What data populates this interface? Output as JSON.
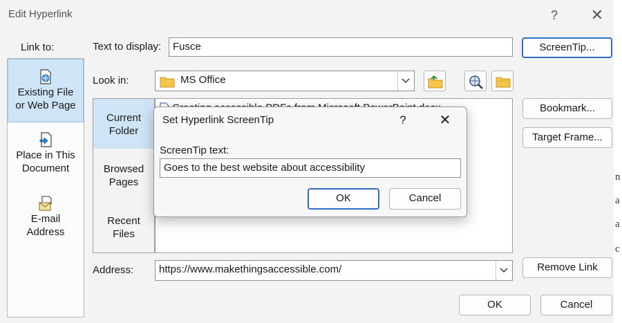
{
  "dialog": {
    "title": "Edit Hyperlink",
    "help_glyph": "?",
    "close_glyph": "✕"
  },
  "link_to": {
    "label": "Link to:",
    "items": [
      {
        "line1": "Existing File",
        "line2": "or Web Page",
        "icon": "globe-file-icon",
        "selected": true
      },
      {
        "line1": "Place in This",
        "line2": "Document",
        "icon": "document-place-icon",
        "selected": false
      },
      {
        "line1": "E-mail",
        "line2": "Address",
        "icon": "envelope-icon",
        "selected": false
      }
    ]
  },
  "text_to_display": {
    "label": "Text to display:",
    "value": "Fusce"
  },
  "look_in": {
    "label": "Look in:",
    "value": "MS Office",
    "icon": "folder-icon"
  },
  "toolbar_icons": [
    "up-folder-icon",
    "browse-web-icon",
    "browse-file-icon"
  ],
  "tabs": [
    {
      "line1": "Current",
      "line2": "Folder",
      "selected": true
    },
    {
      "line1": "Browsed",
      "line2": "Pages",
      "selected": false
    },
    {
      "line1": "Recent",
      "line2": "Files",
      "selected": false
    }
  ],
  "file_list": [
    "Creating accessible PDFs from Microsoft PowerPoint.docx"
  ],
  "address": {
    "label": "Address:",
    "value": "https://www.makethingsaccessible.com/"
  },
  "buttons": {
    "screentip": "ScreenTip...",
    "bookmark": "Bookmark...",
    "target_frame": "Target Frame...",
    "remove_link": "Remove Link",
    "ok": "OK",
    "cancel": "Cancel"
  },
  "screentip_dialog": {
    "title": "Set Hyperlink ScreenTip",
    "help_glyph": "?",
    "close_glyph": "✕",
    "field_label": "ScreenTip text:",
    "field_value": "Goes to the best website about accessibility",
    "ok": "OK",
    "cancel": "Cancel"
  },
  "background_doc_chars": [
    "n",
    "a",
    "a",
    "c"
  ],
  "colors": {
    "selection": "#cfe4f7",
    "focus_border": "#2f6fbf"
  }
}
